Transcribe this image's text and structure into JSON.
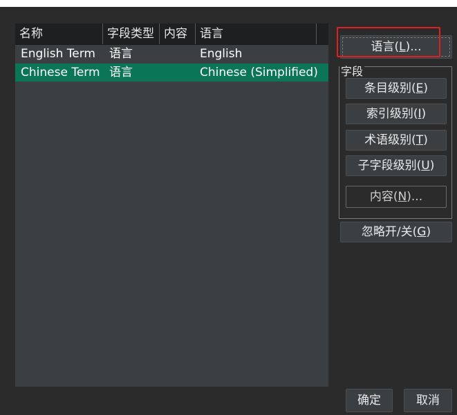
{
  "list": {
    "columns": [
      "名称",
      "字段类型",
      "内容",
      "语言"
    ],
    "rows": [
      {
        "name": "English Term",
        "type": "语言",
        "content": "",
        "language": "English",
        "selected": false
      },
      {
        "name": "Chinese Term",
        "type": "语言",
        "content": "",
        "language": "Chinese (Simplified)",
        "selected": true
      }
    ]
  },
  "buttons": {
    "language": {
      "text": "语言(",
      "key": "L",
      "suffix": ")..."
    },
    "entry_level": {
      "text": "条目级别(",
      "key": "E",
      "suffix": ")"
    },
    "index_level": {
      "text": "索引级别(",
      "key": "I",
      "suffix": ")"
    },
    "term_level": {
      "text": "术语级别(",
      "key": "T",
      "suffix": ")"
    },
    "subfield_level": {
      "text": "子字段级别(",
      "key": "U",
      "suffix": ")"
    },
    "content": {
      "text": "内容(",
      "key": "N",
      "suffix": ")..."
    },
    "ignore_toggle": {
      "text": "忽略开/关(",
      "key": "G",
      "suffix": ")"
    },
    "ok": "确定",
    "cancel": "取消"
  },
  "field_group_label": "字段",
  "colors": {
    "background": "#2b2b2b",
    "list_background": "#3c3f41",
    "selected_row": "#0b7656",
    "highlight_border": "#e02020"
  }
}
